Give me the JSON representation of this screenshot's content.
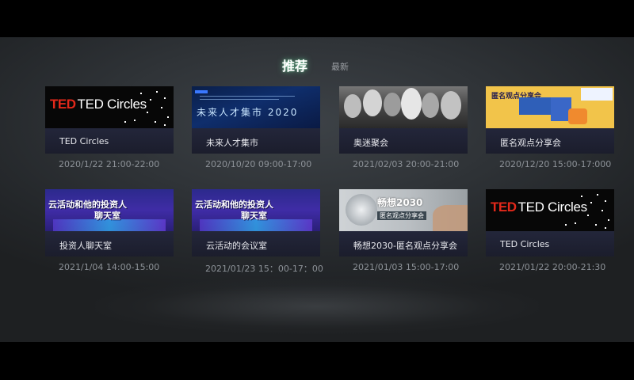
{
  "tabs": {
    "active": "推荐",
    "inactive": "最新"
  },
  "cards": [
    {
      "title": "TED Circles",
      "time": "2020/1/22 21:00-22:00",
      "thumb_text": "TED Circles"
    },
    {
      "title": "未来人才集市",
      "time": "2020/10/20 09:00-17:00",
      "thumb_text": "未来人才集市 2020"
    },
    {
      "title": "奥迷聚会",
      "time": "2021/02/03 20:00-21:00"
    },
    {
      "title": "匿名观点分享会",
      "time": "2020/12/20 15:00-17:000",
      "thumb_text": "匿名观点分享会"
    },
    {
      "title": "投资人聊天室",
      "time": "2021/1/04 14:00-15:00",
      "thumb_text_1": "云活动和他的投资人",
      "thumb_text_2": "聊天室"
    },
    {
      "title": "云活动的会议室",
      "time": "2021/01/23 15：00-17：00",
      "thumb_text_1": "云活动和他的投资人",
      "thumb_text_2": "聊天室"
    },
    {
      "title": "畅想2030-匿名观点分享会",
      "time": "2021/01/03 15:00-17:00",
      "thumb_text_1": "畅想2030",
      "thumb_text_2": "匿名观点分享会"
    },
    {
      "title": "TED Circles",
      "time": "2021/01/22 20:00-21:30",
      "thumb_text": "TED Circles"
    }
  ],
  "colors": {
    "background": "#2f3337",
    "card_title_bg": "#1f2233",
    "active_tab_glow": "#78ffb4",
    "ted_red": "#e3281a"
  }
}
